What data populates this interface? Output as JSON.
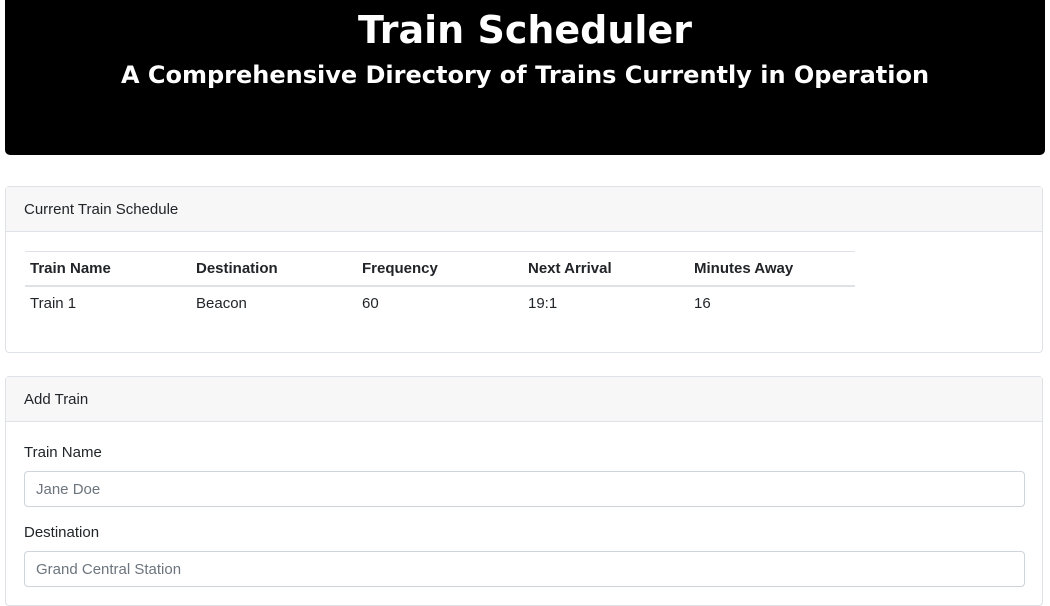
{
  "header": {
    "title": "Train Scheduler",
    "subtitle": "A Comprehensive Directory of Trains Currently in Operation"
  },
  "schedule": {
    "heading": "Current Train Schedule",
    "columns": [
      "Train Name",
      "Destination",
      "Frequency",
      "Next Arrival",
      "Minutes Away"
    ],
    "rows": [
      [
        "Train 1",
        "Beacon",
        "60",
        "19:1",
        "16"
      ]
    ]
  },
  "add_train": {
    "heading": "Add Train",
    "fields": [
      {
        "label": "Train Name",
        "placeholder": "Jane Doe",
        "value": ""
      },
      {
        "label": "Destination",
        "placeholder": "Grand Central Station",
        "value": ""
      }
    ]
  }
}
